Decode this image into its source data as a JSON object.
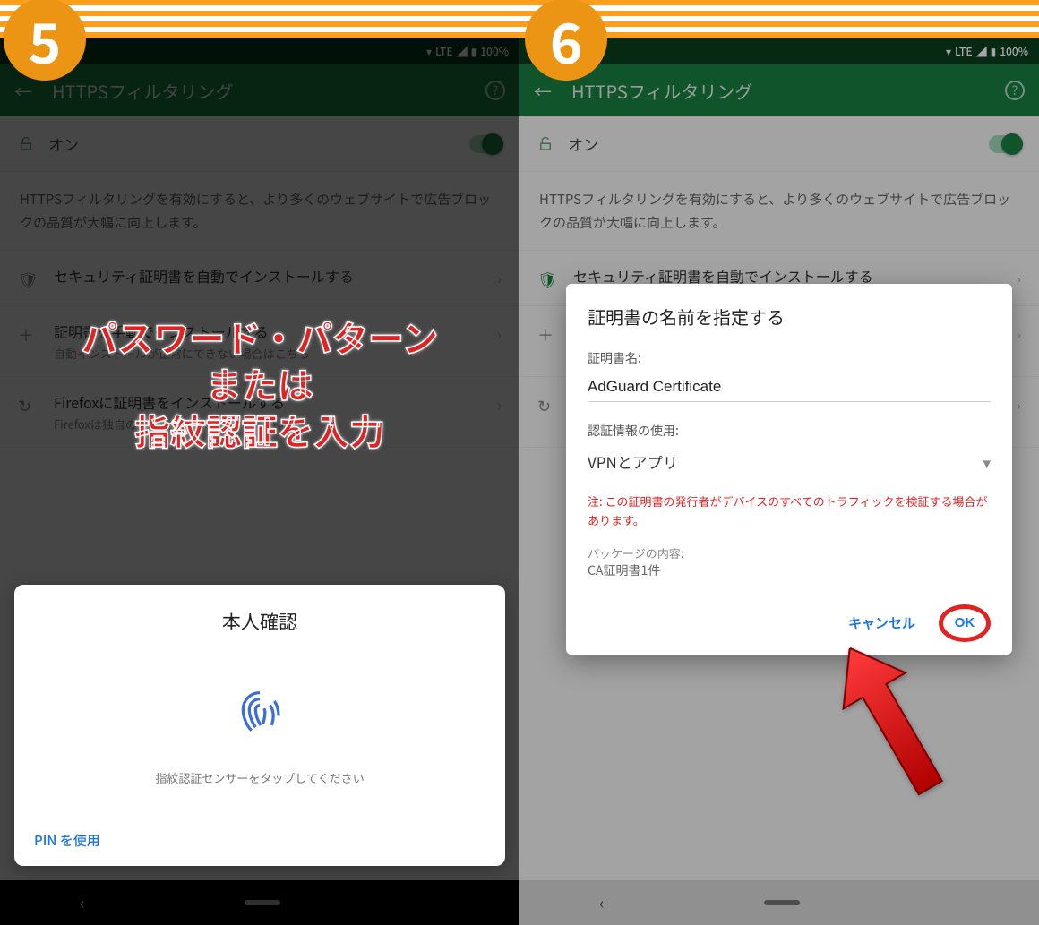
{
  "status": {
    "lte": "LTE",
    "battery": "100%"
  },
  "header": {
    "title": "HTTPSフィルタリング"
  },
  "toggle": {
    "label": "オン"
  },
  "desc": "HTTPSフィルタリングを有効にすると、より多くのウェブサイトで広告ブロックの品質が大幅に向上します。",
  "items": [
    {
      "title": "セキュリティ証明書を自動でインストールする",
      "sub": ""
    },
    {
      "title": "証明書を手動でインストールする",
      "sub": "自動インストールが正常にできない場合はこちら"
    },
    {
      "title": "Firefoxに証明書をインストールする",
      "sub": "Firefoxは独自の証明書ストアを利用しています"
    }
  ],
  "badges": {
    "five": "5",
    "six": "6"
  },
  "annotation": "パスワード・パターン\nまたは\n指紋認証を入力",
  "sheet": {
    "title": "本人確認",
    "sub": "指紋認証センサーをタップしてください",
    "pin_link": "PIN を使用"
  },
  "dialog": {
    "title": "証明書の名前を指定する",
    "name_label": "証明書名:",
    "name_value": "AdGuard Certificate",
    "cred_label": "認証情報の使用:",
    "cred_value": "VPNとアプリ",
    "warning": "注: この証明書の発行者がデバイスのすべてのトラフィックを検証する場合があります。",
    "pkg_label": "パッケージの内容:",
    "pkg_value": "CA証明書1件",
    "cancel": "キャンセル",
    "ok": "OK"
  }
}
